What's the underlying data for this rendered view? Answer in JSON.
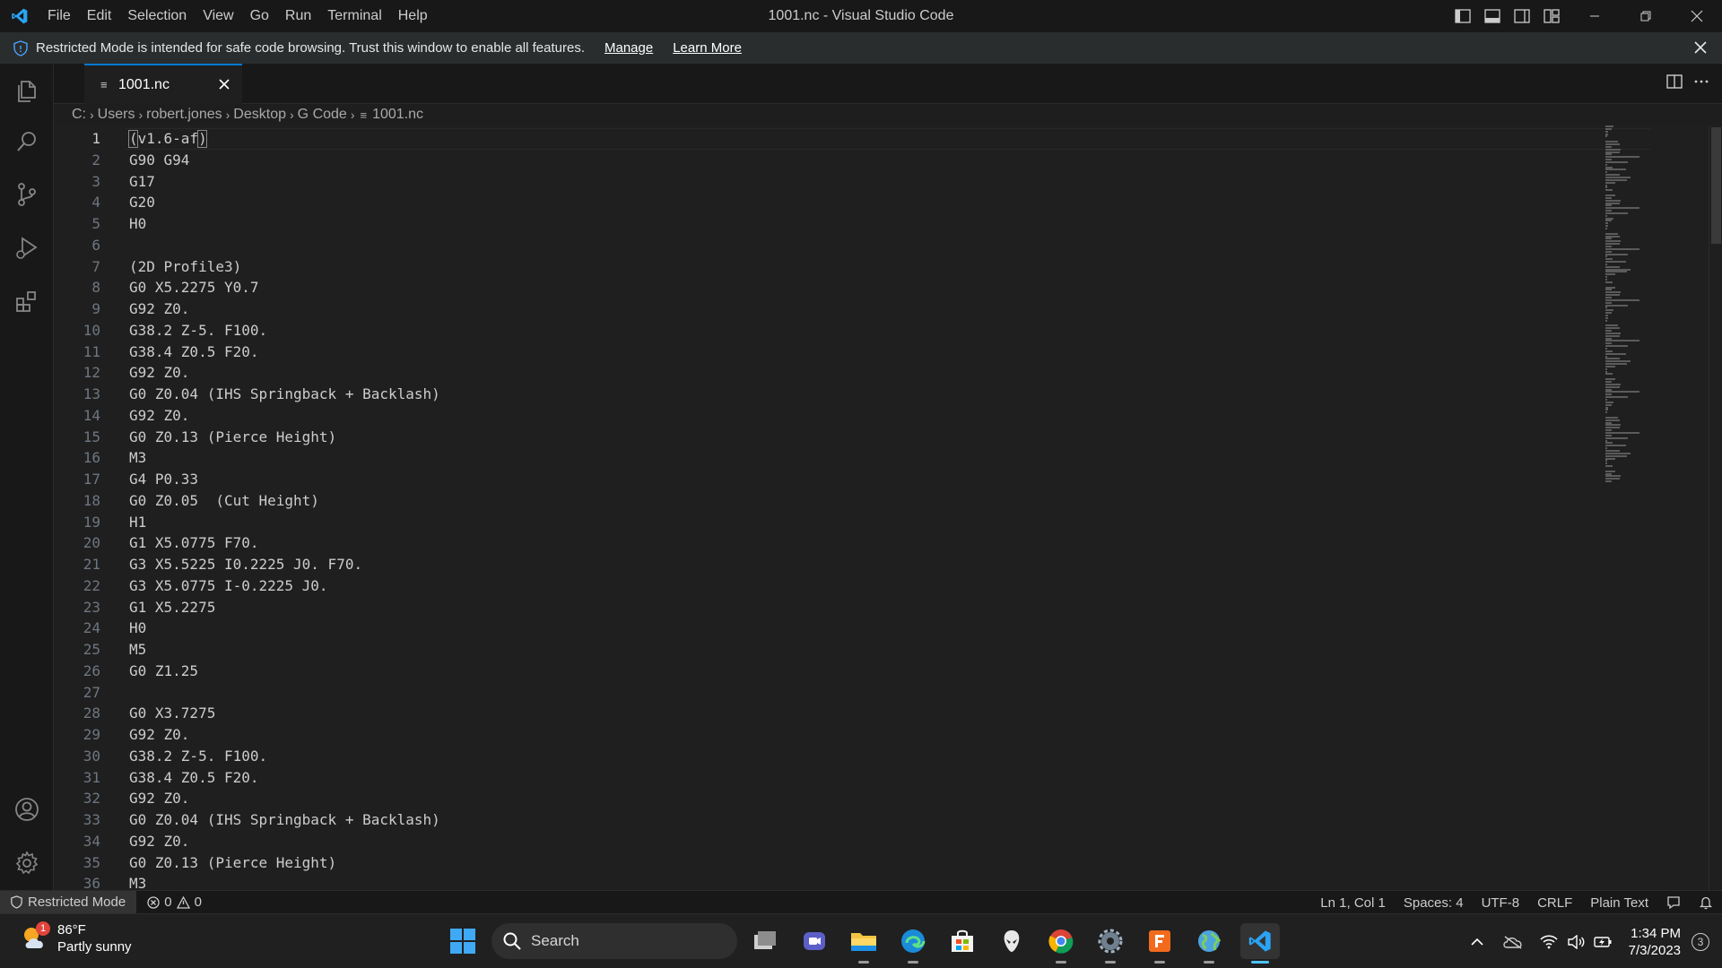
{
  "app": {
    "window_title": "1001.nc - Visual Studio Code",
    "menu": [
      "File",
      "Edit",
      "Selection",
      "View",
      "Go",
      "Run",
      "Terminal",
      "Help"
    ]
  },
  "banner": {
    "message": "Restricted Mode is intended for safe code browsing. Trust this window to enable all features.",
    "manage_label": "Manage",
    "learn_more_label": "Learn More"
  },
  "tab": {
    "label": "1001.nc",
    "file_icon": "≡"
  },
  "breadcrumb": [
    "C:",
    "Users",
    "robert.jones",
    "Desktop",
    "G Code",
    "1001.nc"
  ],
  "editor": {
    "lines": [
      "(v1.6-af)",
      "G90 G94",
      "G17",
      "G20",
      "H0",
      "",
      "(2D Profile3)",
      "G0 X5.2275 Y0.7",
      "G92 Z0.",
      "G38.2 Z-5. F100.",
      "G38.4 Z0.5 F20.",
      "G92 Z0.",
      "G0 Z0.04 (IHS Springback + Backlash)",
      "G92 Z0.",
      "G0 Z0.13 (Pierce Height)",
      "M3",
      "G4 P0.33",
      "G0 Z0.05  (Cut Height)",
      "H1",
      "G1 X5.0775 F70.",
      "G3 X5.5225 I0.2225 J0. F70.",
      "G3 X5.0775 I-0.2225 J0.",
      "G1 X5.2275",
      "H0",
      "M5",
      "G0 Z1.25",
      "",
      "G0 X3.7275",
      "G92 Z0.",
      "G38.2 Z-5. F100.",
      "G38.4 Z0.5 F20.",
      "G92 Z0.",
      "G0 Z0.04 (IHS Springback + Backlash)",
      "G92 Z0.",
      "G0 Z0.13 (Pierce Height)",
      "M3"
    ],
    "active_line": 1
  },
  "status": {
    "restricted_label": "Restricted Mode",
    "errors": "0",
    "warnings": "0",
    "position": "Ln 1, Col 1",
    "spaces": "Spaces: 4",
    "encoding": "UTF-8",
    "eol": "CRLF",
    "language": "Plain Text"
  },
  "taskbar": {
    "weather_temp": "86°F",
    "weather_desc": "Partly sunny",
    "weather_badge": "1",
    "search_label": "Search",
    "time": "1:34 PM",
    "date": "7/3/2023",
    "notification_count": "3",
    "apps": [
      "task-view",
      "teams-chat",
      "file-explorer",
      "edge",
      "microsoft-store",
      "alienware",
      "chrome",
      "settings",
      "fusion-360",
      "browser",
      "vscode"
    ]
  },
  "colors": {
    "accent": "#0078d4",
    "editor_bg": "#1f1f1f",
    "chrome_bg": "#181818",
    "taskbar_bg": "#202020"
  }
}
